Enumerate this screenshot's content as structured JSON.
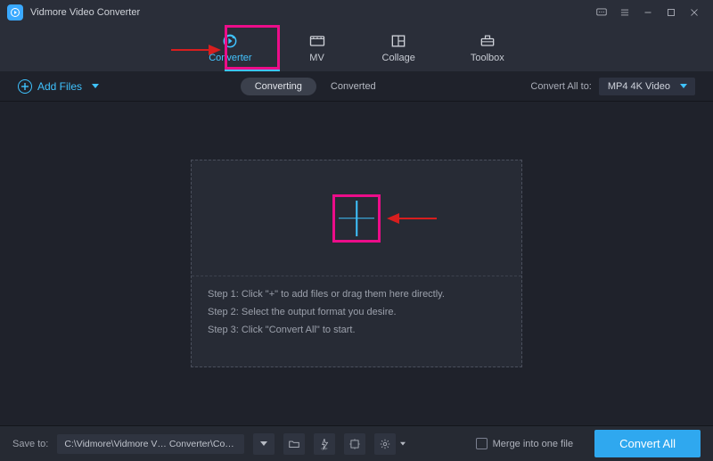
{
  "app": {
    "title": "Vidmore Video Converter"
  },
  "tabs": {
    "converter": "Converter",
    "mv": "MV",
    "collage": "Collage",
    "toolbox": "Toolbox"
  },
  "subbar": {
    "add_files": "Add Files",
    "converting": "Converting",
    "converted": "Converted",
    "convert_all_to_label": "Convert All to:",
    "format_selected": "MP4 4K Video"
  },
  "dropzone": {
    "step1": "Step 1: Click \"+\" to add files or drag them here directly.",
    "step2": "Step 2: Select the output format you desire.",
    "step3": "Step 3: Click \"Convert All\" to start."
  },
  "footer": {
    "save_to_label": "Save to:",
    "save_path": "C:\\Vidmore\\Vidmore V… Converter\\Converted",
    "merge_label": "Merge into one file",
    "convert_all_label": "Convert All"
  }
}
